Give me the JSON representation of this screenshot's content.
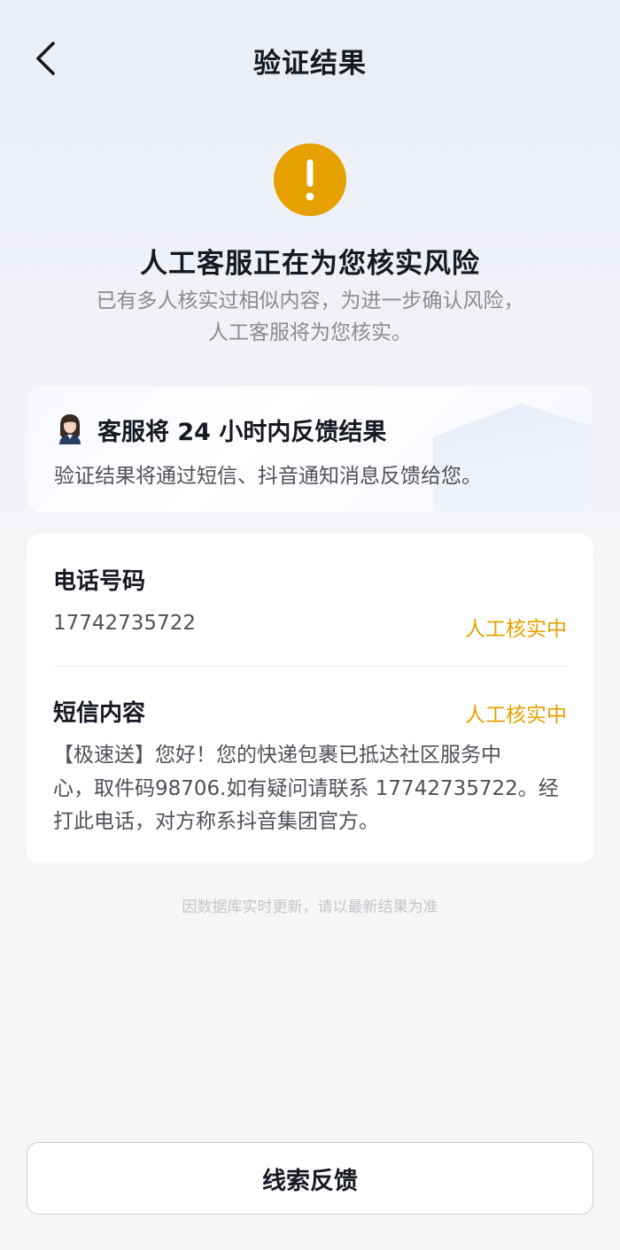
{
  "header": {
    "title": "验证结果",
    "back_icon": "chevron-left-icon"
  },
  "status": {
    "icon": "exclamation-circle-icon",
    "icon_color": "#e6a100",
    "title": "人工客服正在为您核实风险",
    "description_line1": "已有多人核实过相似内容，为进一步确认风险，",
    "description_line2": "人工客服将为您核实。"
  },
  "feedback_card": {
    "avatar_icon": "customer-service-avatar",
    "title": "客服将 24 小时内反馈结果",
    "description": "验证结果将通过短信、抖音通知消息反馈给您。"
  },
  "details": {
    "phone": {
      "label": "电话号码",
      "value": "17742735722",
      "status": "人工核实中"
    },
    "sms": {
      "label": "短信内容",
      "status": "人工核实中",
      "line1": "【极速送】您好！您的快递包裹已抵达社区服务中",
      "line2": "心，取件码98706.如有疑问请联系 17742735722。经",
      "line3": "打此电话，对方称系抖音集团官方。"
    },
    "status_color": "#e6a100"
  },
  "note": "因数据库实时更新，请以最新结果为准",
  "bottom_button": {
    "label": "线索反馈"
  }
}
